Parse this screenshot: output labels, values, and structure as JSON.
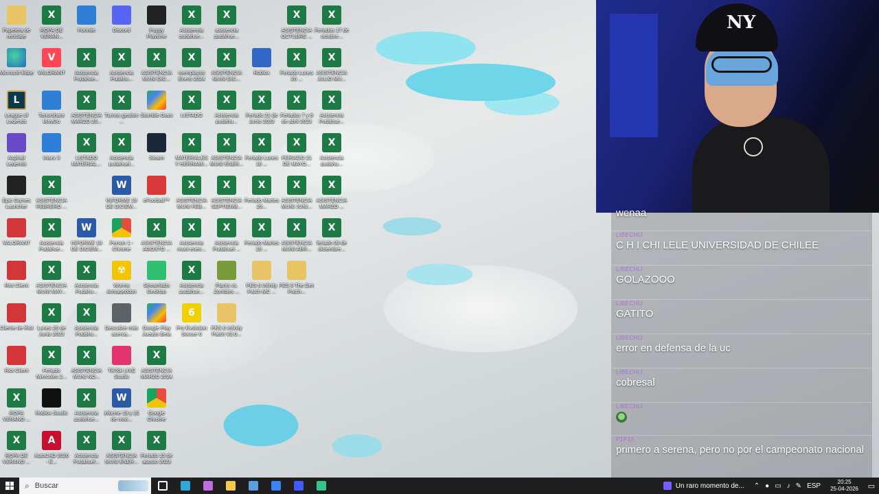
{
  "desktop_icons": [
    {
      "label": "Papelera de reciclaje",
      "kind": "folder",
      "col": 0,
      "row": 0
    },
    {
      "label": "ROPA DE VERAN...",
      "kind": "excel",
      "col": 1,
      "row": 0
    },
    {
      "label": "Fortnite",
      "kind": "blue",
      "col": 2,
      "row": 0
    },
    {
      "label": "Discord",
      "kind": "discord",
      "col": 3,
      "row": 0
    },
    {
      "label": "Poppy Playtime",
      "kind": "dark",
      "col": 4,
      "row": 0
    },
    {
      "label": "Asistencia pudahue...",
      "kind": "excel",
      "col": 5,
      "row": 0
    },
    {
      "label": "asistencia pudahue...",
      "kind": "excel",
      "col": 6,
      "row": 0
    },
    {
      "label": "ASISTENCIA OCTUBRE ...",
      "kind": "excel",
      "col": 8,
      "row": 0
    },
    {
      "label": "Feriados 17 de octubre...",
      "kind": "excel",
      "col": 9,
      "row": 0
    },
    {
      "label": "Microsoft Edge",
      "kind": "edge",
      "col": 0,
      "row": 1
    },
    {
      "label": "VALORANT",
      "kind": "valorant",
      "col": 1,
      "row": 1
    },
    {
      "label": "Asistencia Pudahue...",
      "kind": "excel",
      "col": 2,
      "row": 1
    },
    {
      "label": "Asistencia Pudahu...",
      "kind": "excel",
      "col": 3,
      "row": 1
    },
    {
      "label": "ASISTENCIA MUNI DIC...",
      "kind": "excel",
      "col": 4,
      "row": 1
    },
    {
      "label": "reemplazos Enero 2024",
      "kind": "excel",
      "col": 5,
      "row": 1
    },
    {
      "label": "ASISTENCIA MUNI DIC...",
      "kind": "excel",
      "col": 6,
      "row": 1
    },
    {
      "label": "Roblox",
      "kind": "roblox",
      "col": 7,
      "row": 1
    },
    {
      "label": "Feriado Lunes 26 ...",
      "kind": "excel",
      "col": 8,
      "row": 1
    },
    {
      "label": "ASISTENCIA JULIO MU...",
      "kind": "excel",
      "col": 9,
      "row": 1
    },
    {
      "label": "League of Legends",
      "kind": "lol",
      "col": 0,
      "row": 2
    },
    {
      "label": "Tenorshare iAnyGo",
      "kind": "blue",
      "col": 1,
      "row": 2
    },
    {
      "label": "ASISTENCIA MARZO 20...",
      "kind": "excel",
      "col": 2,
      "row": 2
    },
    {
      "label": "Turnos gestion ...",
      "kind": "excel",
      "col": 3,
      "row": 2
    },
    {
      "label": "Stumble Guys",
      "kind": "gplay",
      "col": 4,
      "row": 2
    },
    {
      "label": "LISTADO",
      "kind": "excel",
      "col": 5,
      "row": 2
    },
    {
      "label": "Asistencia pudahu...",
      "kind": "excel",
      "col": 6,
      "row": 2
    },
    {
      "label": "Feriado 21 de Junio 2023",
      "kind": "excel",
      "col": 7,
      "row": 2
    },
    {
      "label": "Feriados 7 y 8 de abril 2023",
      "kind": "excel",
      "col": 8,
      "row": 2
    },
    {
      "label": "Asistencia Pudahue...",
      "kind": "excel",
      "col": 9,
      "row": 2
    },
    {
      "label": "Asphalt Legends",
      "kind": "purple",
      "col": 0,
      "row": 3
    },
    {
      "label": "Injury 3",
      "kind": "blue",
      "col": 1,
      "row": 3
    },
    {
      "label": "LISTADO MATERIAL...",
      "kind": "excel",
      "col": 2,
      "row": 3
    },
    {
      "label": "Asistencia pudahuel...",
      "kind": "excel",
      "col": 3,
      "row": 3
    },
    {
      "label": "Steam",
      "kind": "steam",
      "col": 4,
      "row": 3
    },
    {
      "label": "MATERIALES Y HERRAMI...",
      "kind": "excel",
      "col": 5,
      "row": 3
    },
    {
      "label": "ASISTENCIA MUNI ENER...",
      "kind": "excel",
      "col": 6,
      "row": 3
    },
    {
      "label": "Feriado Lunes 18 ...",
      "kind": "excel",
      "col": 7,
      "row": 3
    },
    {
      "label": "FERIADO 21 DE MAYO...",
      "kind": "excel",
      "col": 8,
      "row": 3
    },
    {
      "label": "Asistencia pudahu...",
      "kind": "excel",
      "col": 9,
      "row": 3
    },
    {
      "label": "Epic Games Launcher",
      "kind": "dark",
      "col": 0,
      "row": 4
    },
    {
      "label": "ASISTENCIA FEBRERO ...",
      "kind": "excel",
      "col": 1,
      "row": 4
    },
    {
      "label": "INFORME 18 DE DICIEM...",
      "kind": "word",
      "col": 3,
      "row": 4
    },
    {
      "label": "eFootball™",
      "kind": "red",
      "col": 4,
      "row": 4
    },
    {
      "label": "ASISTENCIA MUNI FEB...",
      "kind": "excel",
      "col": 5,
      "row": 4
    },
    {
      "label": "ASISTENCIA SEPTIEMB...",
      "kind": "excel",
      "col": 6,
      "row": 4
    },
    {
      "label": "Feriado Martes 29...",
      "kind": "excel",
      "col": 7,
      "row": 4
    },
    {
      "label": "ASISTENCIA MUNI JUNI...",
      "kind": "excel",
      "col": 8,
      "row": 4
    },
    {
      "label": "ASISTENCIA MARZO ...",
      "kind": "excel",
      "col": 9,
      "row": 4
    },
    {
      "label": "VALORANT",
      "kind": "riot",
      "col": 0,
      "row": 5
    },
    {
      "label": "Asistencia Pudahue...",
      "kind": "excel",
      "col": 1,
      "row": 5
    },
    {
      "label": "INFORME 18 DE DICIEM...",
      "kind": "word",
      "col": 2,
      "row": 5
    },
    {
      "label": "Person 1 - Chrome",
      "kind": "chrome",
      "col": 3,
      "row": 5
    },
    {
      "label": "ASISTENCIA AGOSTO ...",
      "kind": "excel",
      "col": 4,
      "row": 5
    },
    {
      "label": "Asistencia muni eneo...",
      "kind": "excel",
      "col": 5,
      "row": 5
    },
    {
      "label": "Asistencia Pudahuel ...",
      "kind": "excel",
      "col": 6,
      "row": 5
    },
    {
      "label": "Feriado Martes 19 ...",
      "kind": "excel",
      "col": 7,
      "row": 5
    },
    {
      "label": "ASISTENCIA MUNI ABR...",
      "kind": "excel",
      "col": 8,
      "row": 5
    },
    {
      "label": "feriado 08 de diciembre...",
      "kind": "excel",
      "col": 9,
      "row": 5
    },
    {
      "label": "Riot Client",
      "kind": "riot",
      "col": 0,
      "row": 6
    },
    {
      "label": "ASISTENCIA MUNI MAY...",
      "kind": "excel",
      "col": 1,
      "row": 6
    },
    {
      "label": "Asistencia Pudahu...",
      "kind": "excel",
      "col": 2,
      "row": 6
    },
    {
      "label": "Worms Armageddon",
      "kind": "nuke",
      "col": 3,
      "row": 6
    },
    {
      "label": "Streamlabs Desktop",
      "kind": "green",
      "col": 4,
      "row": 6
    },
    {
      "label": "Asistencia pudahue...",
      "kind": "excel",
      "col": 5,
      "row": 6
    },
    {
      "label": "Plants vs. Zombies ...",
      "kind": "plant",
      "col": 6,
      "row": 6
    },
    {
      "label": "PES 6 Infinity Patch MC ...",
      "kind": "folder",
      "col": 7,
      "row": 6
    },
    {
      "label": "PES 6 The Den Patch...",
      "kind": "folder",
      "col": 8,
      "row": 6
    },
    {
      "label": "Cliente de Riot",
      "kind": "riot",
      "col": 0,
      "row": 7
    },
    {
      "label": "Lunes 26 de Junio 2023",
      "kind": "excel",
      "col": 1,
      "row": 7
    },
    {
      "label": "Asistencia Pudahu...",
      "kind": "excel",
      "col": 2,
      "row": 7
    },
    {
      "label": "Descubre más acerca...",
      "kind": "gray",
      "col": 3,
      "row": 7
    },
    {
      "label": "Google Play Juegos Beta",
      "kind": "gplay",
      "col": 4,
      "row": 7
    },
    {
      "label": "Pro Evolution Soccer 6",
      "kind": "pes",
      "col": 5,
      "row": 7
    },
    {
      "label": "PES 6 Infinity Patch V2.0...",
      "kind": "folder",
      "col": 6,
      "row": 7
    },
    {
      "label": "Riot Client",
      "kind": "riot",
      "col": 0,
      "row": 8
    },
    {
      "label": "Feriado Miercoles 2...",
      "kind": "excel",
      "col": 1,
      "row": 8
    },
    {
      "label": "ASISTENCIA MUNI NO...",
      "kind": "excel",
      "col": 2,
      "row": 8
    },
    {
      "label": "TikTok LIVE Studio",
      "kind": "pink",
      "col": 3,
      "row": 8
    },
    {
      "label": "ASISTENCIA MARZO 2024",
      "kind": "excel",
      "col": 4,
      "row": 8
    },
    {
      "label": "ROPA VERANO ...",
      "kind": "excel",
      "col": 0,
      "row": 9
    },
    {
      "label": "Roblox Studio",
      "kind": "tiktok",
      "col": 1,
      "row": 9
    },
    {
      "label": "Asistencia pudahue...",
      "kind": "excel",
      "col": 2,
      "row": 9
    },
    {
      "label": "informe 19 y 20 de novi...",
      "kind": "word",
      "col": 3,
      "row": 9
    },
    {
      "label": "Google Chrome",
      "kind": "chrome",
      "col": 4,
      "row": 9
    },
    {
      "label": "ROPA DE VERANO ...",
      "kind": "excel",
      "col": 0,
      "row": 10
    },
    {
      "label": "AutoCAD 2026 - E...",
      "kind": "autocad",
      "col": 1,
      "row": 10
    },
    {
      "label": "Asistencia Pudahuel...",
      "kind": "excel",
      "col": 2,
      "row": 10
    },
    {
      "label": "ASISTENCIA MUNI ENER...",
      "kind": "excel",
      "col": 3,
      "row": 10
    },
    {
      "label": "Feriado 15 de agosto 2023",
      "kind": "excel",
      "col": 4,
      "row": 10
    }
  ],
  "icon_glyphs": {
    "excel": "X",
    "word": "W",
    "folder": "",
    "edge": "",
    "chrome": "",
    "red": "",
    "riot": "",
    "steam": "",
    "roblox": "",
    "discord": "",
    "dark": "",
    "purple": "",
    "valorant": "V",
    "blue": "",
    "nuke": "☢",
    "green": "",
    "pink": "",
    "gray": "",
    "pes": "6",
    "autocad": "A",
    "plant": "",
    "lol": "L",
    "tiktok": "",
    "gplay": ""
  },
  "webcam": {
    "cap_logo": "NY"
  },
  "chat": {
    "messages": [
      {
        "user": "",
        "text": "wenaa"
      },
      {
        "user": "LIBECHIJ",
        "text": "C H I CHI LELE UNIVERSIDAD DE CHILEE"
      },
      {
        "user": "LIBECHIJ",
        "text": "GOLAZOOO"
      },
      {
        "user": "LIBECHIJ",
        "text": "GATITO"
      },
      {
        "user": "LIBECHIJ",
        "text": "error en defensa de la uc"
      },
      {
        "user": "LIBECHIJ",
        "text": "cobresal"
      },
      {
        "user": "LIBECHIJ",
        "text": "",
        "emote": true
      },
      {
        "user": "P1P33",
        "text": "primero a serena, pero no por el campeonato nacional"
      }
    ]
  },
  "taskbar": {
    "search_placeholder": "Buscar",
    "media_title": "Un raro momento de...",
    "language": "ESP",
    "time": "20:25",
    "date": "25-04-2026",
    "apps": [
      "task-view",
      "edge",
      "copilot",
      "file-explorer",
      "store",
      "mail",
      "streamer",
      "streamlabs"
    ],
    "app_colors": {
      "task-view": "#ffffff",
      "edge": "#2fa7d8",
      "copilot": "#c36be0",
      "file-explorer": "#f2c94c",
      "store": "#5aa0e0",
      "mail": "#3b82f6",
      "streamer": "#3f5bff",
      "streamlabs": "#31c48d"
    }
  }
}
